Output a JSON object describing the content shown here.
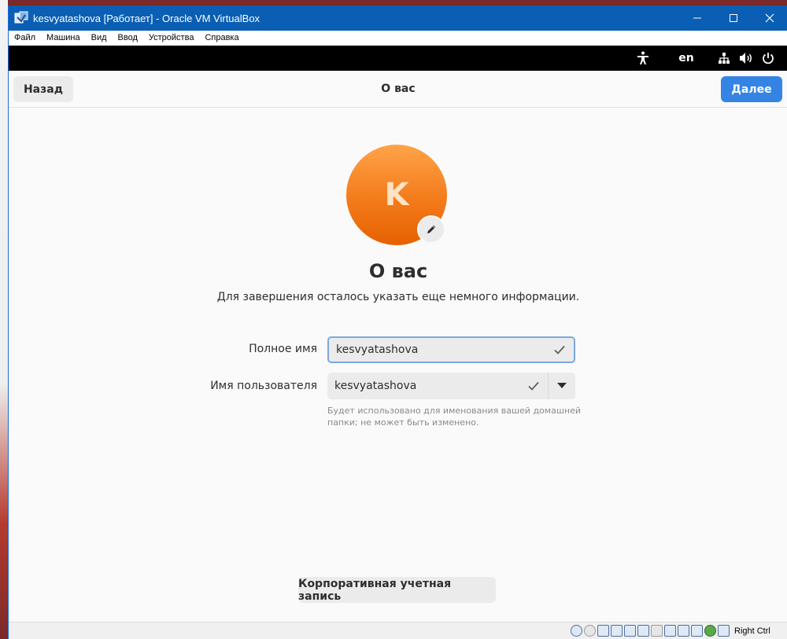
{
  "window": {
    "title": "kesvyatashova [Работает] - Oracle VM VirtualBox",
    "icons": [
      "virtualbox-icon",
      "minimize-icon",
      "maximize-icon",
      "close-icon"
    ]
  },
  "menubar": {
    "items": [
      "Файл",
      "Машина",
      "Вид",
      "Ввод",
      "Устройства",
      "Справка"
    ]
  },
  "topbar": {
    "language": "en",
    "icons": [
      "accessibility-icon",
      "network-icon",
      "volume-icon",
      "power-icon"
    ]
  },
  "header": {
    "back_label": "Назад",
    "title": "О вас",
    "next_label": "Далее"
  },
  "avatar": {
    "initial": "K"
  },
  "main": {
    "title": "О вас",
    "subtitle": "Для завершения осталось указать еще немного информации."
  },
  "form": {
    "full_name_label": "Полное имя",
    "full_name_value": "kesvyatashova",
    "username_label": "Имя пользователя",
    "username_value": "kesvyatashova",
    "username_hint": "Будет использовано для именования вашей домашней папки; не может быть изменено."
  },
  "footer": {
    "enterprise_label": "Корпоративная учетная запись"
  },
  "statusbar": {
    "host_key": "Right Ctrl"
  },
  "colors": {
    "accent": "#3584e4",
    "titlebar": "#0a5fb4",
    "avatar": "#f37b1b"
  }
}
